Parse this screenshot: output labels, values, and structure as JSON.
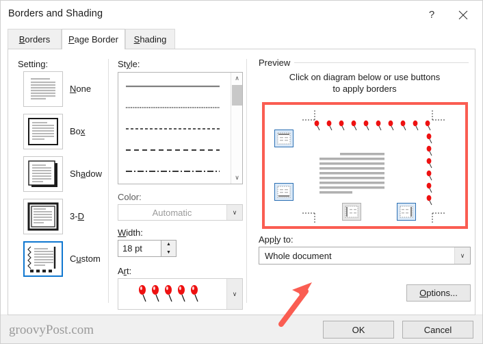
{
  "window": {
    "title": "Borders and Shading",
    "help_label": "?",
    "close_label": "✕"
  },
  "tabs": [
    {
      "id": "borders",
      "label": "Borders",
      "accel": "B",
      "active": false
    },
    {
      "id": "page-border",
      "label": "Page Border",
      "accel": "P",
      "active": true
    },
    {
      "id": "shading",
      "label": "Shading",
      "accel": "S",
      "active": false
    }
  ],
  "setting": {
    "label": "Setting:",
    "options": [
      {
        "id": "none",
        "label": "None",
        "accel": "N",
        "selected": false
      },
      {
        "id": "box",
        "label": "Box",
        "accel": "x",
        "selected": false
      },
      {
        "id": "shadow",
        "label": "Shadow",
        "accel": "a",
        "selected": false
      },
      {
        "id": "3d",
        "label": "3-D",
        "accel": "D",
        "selected": false
      },
      {
        "id": "custom",
        "label": "Custom",
        "accel": "u",
        "selected": true
      }
    ]
  },
  "style": {
    "label": "Style:",
    "items": [
      "solid",
      "dotted",
      "dashed-fine",
      "dashed",
      "dash-dot"
    ],
    "scroll_up": "∧",
    "scroll_down": "∨"
  },
  "color": {
    "label": "Color:",
    "value": "Automatic",
    "arrow": "∨"
  },
  "width": {
    "label": "Width:",
    "accel": "W",
    "value": "18 pt",
    "spin_up": "▲",
    "spin_down": "▼"
  },
  "art": {
    "label": "Art:",
    "accel": "r",
    "value": "pushpin-art-border",
    "arrow": "∨"
  },
  "preview": {
    "label": "Preview",
    "hint_line1": "Click on diagram below or use buttons",
    "hint_line2": "to apply borders",
    "buttons": [
      {
        "id": "top-border",
        "name": "top-border-toggle",
        "state": "on"
      },
      {
        "id": "bottom-border",
        "name": "bottom-border-toggle",
        "state": "on"
      },
      {
        "id": "left-border",
        "name": "left-border-toggle",
        "state": "off"
      },
      {
        "id": "right-border",
        "name": "right-border-toggle",
        "state": "on"
      }
    ],
    "applied_borders": [
      "top",
      "right"
    ],
    "highlight_color": "#FA5D52",
    "art_color": "#EE1111"
  },
  "apply_to": {
    "label": "Apply to:",
    "accel": "l",
    "value": "Whole document",
    "arrow": "∨"
  },
  "options_button": {
    "label": "Options...",
    "accel": "O"
  },
  "footer": {
    "watermark": "groovyPost.com",
    "ok_label": "OK",
    "cancel_label": "Cancel"
  }
}
